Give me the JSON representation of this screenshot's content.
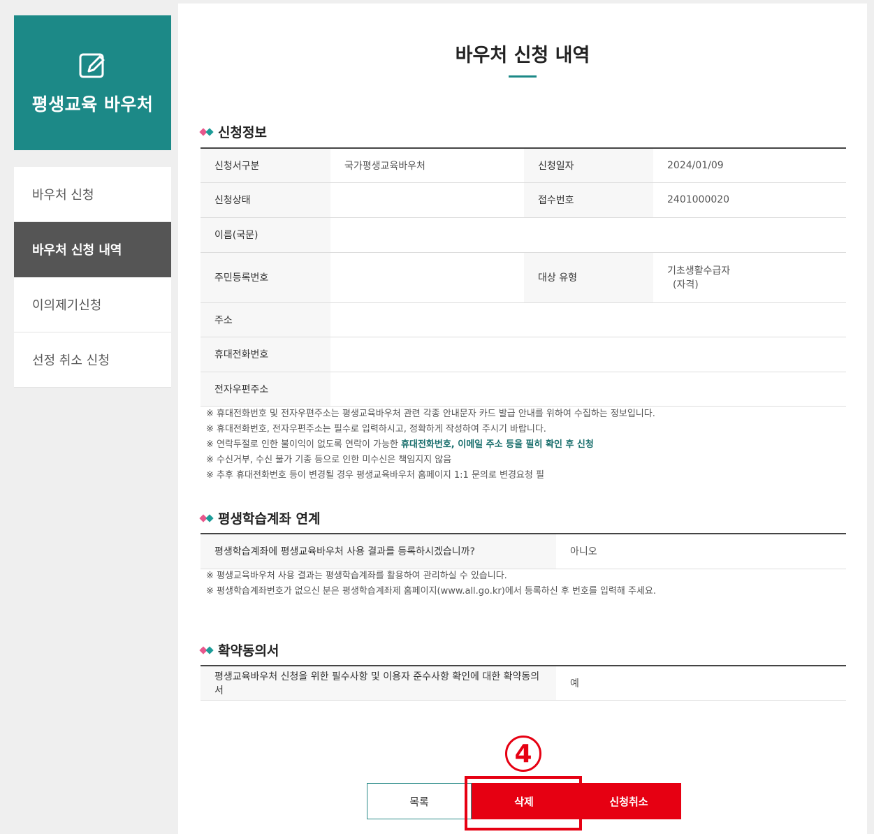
{
  "sidebar": {
    "title": "평생교육 바우처",
    "items": [
      {
        "label": "바우처 신청"
      },
      {
        "label": "바우처 신청 내역"
      },
      {
        "label": "이의제기신청"
      },
      {
        "label": "선정 취소 신청"
      }
    ]
  },
  "page": {
    "title": "바우처 신청 내역"
  },
  "application_info": {
    "heading": "신청정보",
    "rows": {
      "type_label": "신청서구분",
      "type_value": "국가평생교육바우처",
      "date_label": "신청일자",
      "date_value": "2024/01/09",
      "status_label": "신청상태",
      "status_value": "",
      "receipt_label": "접수번호",
      "receipt_value": "2401000020",
      "name_label": "이름(국문)",
      "name_value": "",
      "rrn_label": "주민등록번호",
      "rrn_value": "",
      "target_label": "대상 유형",
      "target_value_1": "기초생활수급자",
      "target_value_2": "(자격)",
      "address_label": "주소",
      "address_value": "",
      "phone_label": "휴대전화번호",
      "phone_value": "",
      "email_label": "전자우편주소",
      "email_value": ""
    },
    "notes": [
      "※ 휴대전화번호 및 전자우편주소는 평생교육바우처 관련 각종 안내문자 카드 발급 안내를 위하여 수집하는 정보입니다.",
      "※ 휴대전화번호, 전자우편주소는 필수로 입력하시고, 정확하게 작성하여 주시기 바랍니다.",
      "※ 연락두절로 인한 불이익이 없도록 연락이 가능한 ",
      "휴대전화번호, 이메일 주소 등을 필히 확인 후 신청",
      "※ 수신거부, 수신 불가 기종 등으로 인한 미수신은 책임지지 않음",
      "※ 추후 휴대전화번호 등이 변경될 경우 평생교육바우처 홈페이지 1:1 문의로 변경요청 필"
    ]
  },
  "account_link": {
    "heading": "평생학습계좌 연계",
    "question": "평생학습계좌에 평생교육바우처 사용 결과를 등록하시겠습니까?",
    "answer": "아니오",
    "notes": [
      "※ 평생교육바우처 사용 결과는 평생학습계좌를 활용하여 관리하실 수 있습니다.",
      "※ 평생학습계좌번호가 없으신 분은 평생학습계좌제 홈페이지(www.all.go.kr)에서 등록하신 후 번호를 입력해 주세요."
    ]
  },
  "agreement": {
    "heading": "확약동의서",
    "question": "평생교육바우처 신청을 위한 필수사항 및 이용자 준수사항 확인에 대한 확약동의서",
    "answer": "예"
  },
  "buttons": {
    "list": "목록",
    "delete": "삭제",
    "cancel": "신청취소"
  },
  "annotation": {
    "step": "4"
  },
  "colors": {
    "brand": "#1c8987",
    "red": "#e60012",
    "active_menu": "#555555"
  }
}
